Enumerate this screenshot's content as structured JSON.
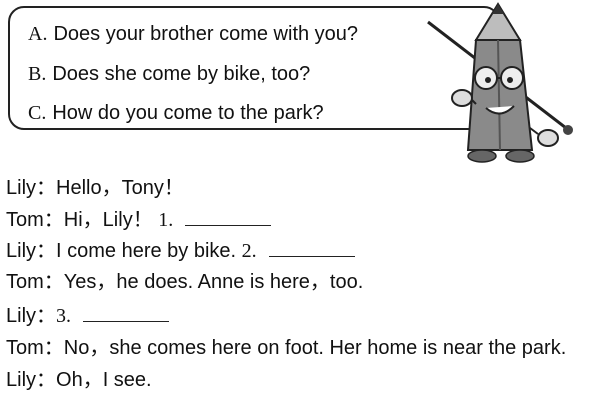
{
  "options": [
    {
      "letter": "A.",
      "text": "Does your brother come with you?"
    },
    {
      "letter": "B.",
      "text": "Does she come by bike, too?"
    },
    {
      "letter": "C.",
      "text": "How do you come to the park?"
    }
  ],
  "dialogue": [
    {
      "speaker": "Lily：",
      "text": "Hello，Tony！",
      "num": ""
    },
    {
      "speaker": "Tom：",
      "text": "Hi，Lily！",
      "num": "1."
    },
    {
      "speaker": "Lily：",
      "text": "I come here by bike.",
      "num": "2."
    },
    {
      "speaker": "Tom：",
      "text": "Yes，he does. Anne is here，too.",
      "num": ""
    },
    {
      "speaker": "Lily：",
      "text": "",
      "num": "3."
    },
    {
      "speaker": "Tom：",
      "text": "No，she comes here on foot. Her home is near the park.",
      "num": ""
    },
    {
      "speaker": "Lily：",
      "text": "Oh，I see.",
      "num": ""
    }
  ]
}
